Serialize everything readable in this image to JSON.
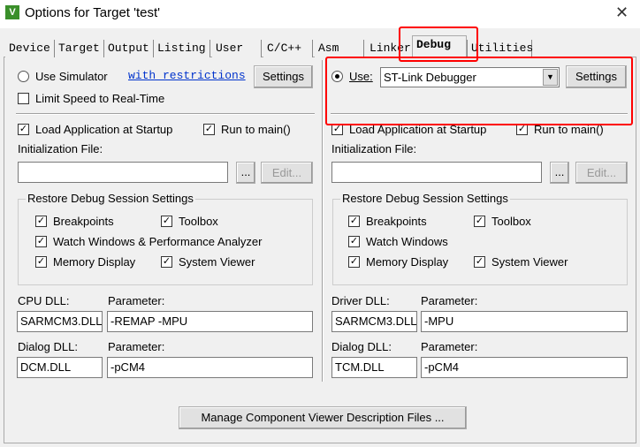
{
  "window": {
    "title": "Options for Target 'test'",
    "icon": "keil-uvision-icon",
    "close": "✕"
  },
  "tabs": [
    "Device",
    "Target",
    "Output",
    "Listing",
    "User",
    "C/C++",
    "Asm",
    "Linker",
    "Debug",
    "Utilities"
  ],
  "selected_tab": "Debug",
  "highlight_color": "#ff0000",
  "left": {
    "use_simulator": "Use Simulator",
    "with_restrictions": "with restrictions",
    "settings": "Settings",
    "limit_speed": "Limit Speed to Real-Time",
    "load_app": "Load Application at Startup",
    "run_to_main": "Run to main()",
    "init_file_label": "Initialization File:",
    "init_file_value": "",
    "browse": "...",
    "edit": "Edit...",
    "restore_group": "Restore Debug Session Settings",
    "breakpoints": "Breakpoints",
    "toolbox": "Toolbox",
    "watch": "Watch Windows & Performance Analyzer",
    "memory": "Memory Display",
    "sysviewer": "System Viewer",
    "cpu_dll_label": "CPU DLL:",
    "cpu_param_label": "Parameter:",
    "cpu_dll": "SARMCM3.DLL",
    "cpu_param": "-REMAP -MPU",
    "dialog_dll_label": "Dialog DLL:",
    "dialog_param_label": "Parameter:",
    "dialog_dll": "DCM.DLL",
    "dialog_param": "-pCM4"
  },
  "right": {
    "use": "Use:",
    "debugger": "ST-Link Debugger",
    "settings": "Settings",
    "load_app": "Load Application at Startup",
    "run_to_main": "Run to main()",
    "init_file_label": "Initialization File:",
    "init_file_value": "",
    "browse": "...",
    "edit": "Edit...",
    "restore_group": "Restore Debug Session Settings",
    "breakpoints": "Breakpoints",
    "toolbox": "Toolbox",
    "watch": "Watch Windows",
    "memory": "Memory Display",
    "sysviewer": "System Viewer",
    "driver_dll_label": "Driver DLL:",
    "driver_param_label": "Parameter:",
    "driver_dll": "SARMCM3.DLL",
    "driver_param": "-MPU",
    "dialog_dll_label": "Dialog DLL:",
    "dialog_param_label": "Parameter:",
    "dialog_dll": "TCM.DLL",
    "dialog_param": "-pCM4"
  },
  "manage_button": "Manage Component Viewer Description Files ..."
}
